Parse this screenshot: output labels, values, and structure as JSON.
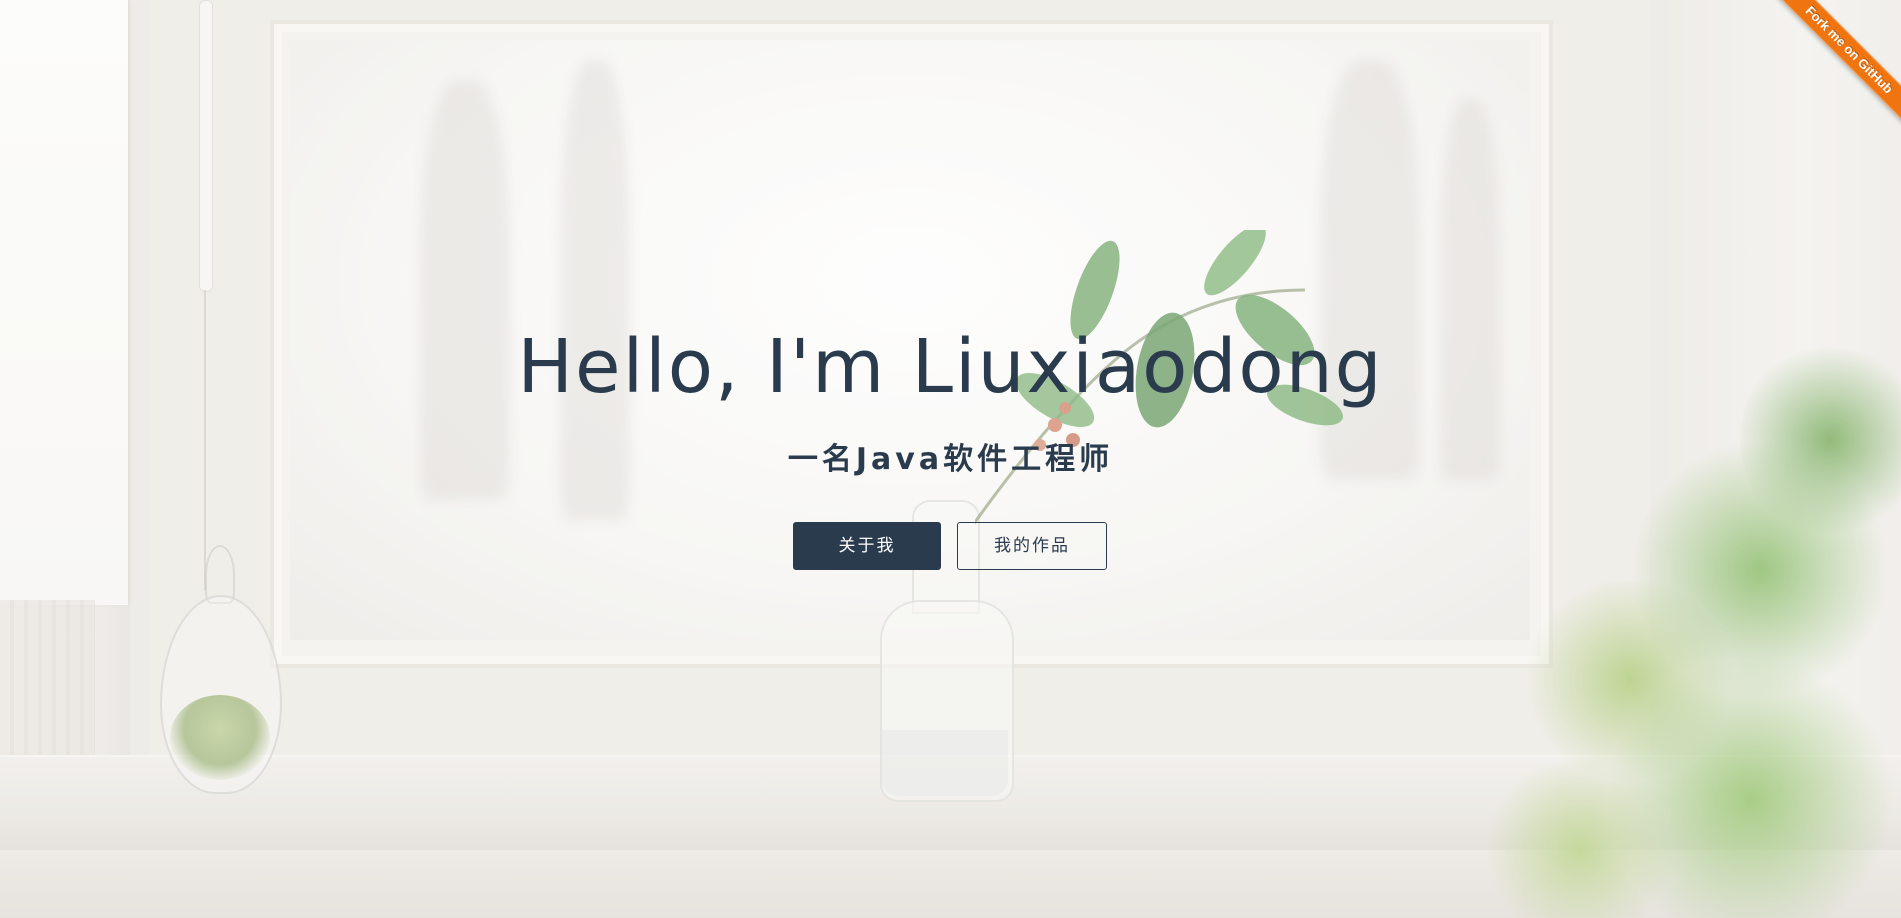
{
  "hero": {
    "title": "Hello, I'm Liuxiaodong",
    "subtitle": "一名Java软件工程师"
  },
  "buttons": {
    "about_label": "关于我",
    "works_label": "我的作品"
  },
  "ribbon": {
    "label": "Fork me on GitHub"
  },
  "colors": {
    "text_dark": "#2a3b4e",
    "ribbon": "#f0740f",
    "background": "#e9e6e0"
  }
}
